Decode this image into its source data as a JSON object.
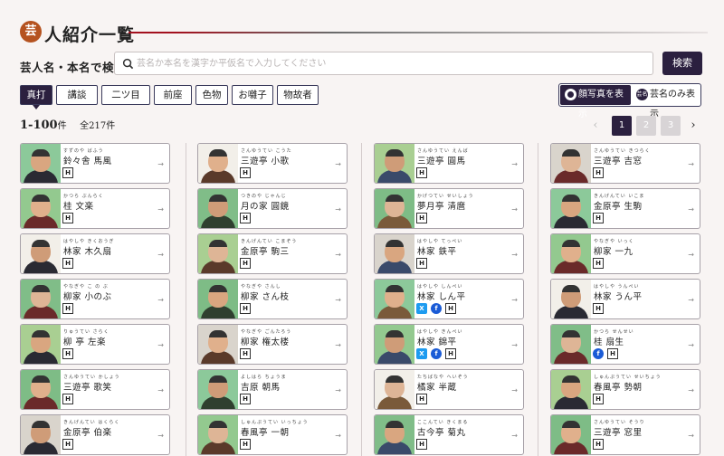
{
  "header": {
    "badge": "芸",
    "title": "人紹介一覧"
  },
  "search": {
    "label": "芸人名・本名で検索",
    "placeholder": "芸名か本名を漢字か平仮名で入力してください",
    "button": "検索"
  },
  "tabs": [
    "真打",
    "講談",
    "二ツ目",
    "前座",
    "色物",
    "お囃子",
    "物故者"
  ],
  "active_tab": "真打",
  "view": {
    "photo_label": "顔写真を表示",
    "name_label": "芸名のみ表示",
    "name_icon": "芸名"
  },
  "results": {
    "range": "1-100",
    "unit": "件",
    "total": "全217件"
  },
  "pagination": {
    "prev": "‹",
    "next": "›",
    "pages": [
      "1",
      "2",
      "3"
    ],
    "current": "1"
  },
  "columns": [
    [
      {
        "ruby": "すずのや ばふう",
        "name": "鈴々舎 馬風",
        "icons": [
          "H"
        ]
      },
      {
        "ruby": "かつら ぶんらく",
        "name": "桂 文楽",
        "icons": [
          "H"
        ]
      },
      {
        "ruby": "はやしや きくおうぎ",
        "name": "林家 木久扇",
        "icons": [
          "H"
        ]
      },
      {
        "ruby": "やなぎや こ の ぶ",
        "name": "柳家 小のぶ",
        "icons": [
          "H"
        ]
      },
      {
        "ruby": "りゅうてい さらく",
        "name": "柳 亭 左楽",
        "icons": [
          "H"
        ]
      },
      {
        "ruby": "さんゆうてい かしょう",
        "name": "三遊亭 歌笑",
        "icons": [
          "H"
        ]
      },
      {
        "ruby": "きんげんてい はくらく",
        "name": "金原亭 伯楽",
        "icons": [
          "H"
        ]
      }
    ],
    [
      {
        "ruby": "さんゆうてい こうた",
        "name": "三遊亭 小歌",
        "icons": [
          "H"
        ]
      },
      {
        "ruby": "つきのや じゃんじ",
        "name": "月の家 圓鏡",
        "icons": [
          "H"
        ]
      },
      {
        "ruby": "きんげんてい こまぞう",
        "name": "金原亭 駒三",
        "icons": [
          "H"
        ]
      },
      {
        "ruby": "やなぎや さんし",
        "name": "柳家 さん枝",
        "icons": [
          "H"
        ]
      },
      {
        "ruby": "やなぎや ごんたろう",
        "name": "柳家 権太楼",
        "icons": [
          "H"
        ]
      },
      {
        "ruby": "よしはら ちょうま",
        "name": "吉原 朝馬",
        "icons": [
          "H"
        ]
      },
      {
        "ruby": "しゅんぷうてい いっちょう",
        "name": "春風亭 一朝",
        "icons": [
          "H"
        ]
      }
    ],
    [
      {
        "ruby": "さんゆうてい えんば",
        "name": "三遊亭 圓馬",
        "icons": [
          "H"
        ]
      },
      {
        "ruby": "かげつてい せいしょう",
        "name": "夢月亭 清麿",
        "icons": [
          "H"
        ]
      },
      {
        "ruby": "はやしや てっぺい",
        "name": "林家 鉄平",
        "icons": [
          "H"
        ]
      },
      {
        "ruby": "はやしや しんぺい",
        "name": "林家 しん平",
        "icons": [
          "X",
          "f",
          "H"
        ]
      },
      {
        "ruby": "はやしや きんぺい",
        "name": "林家 錦平",
        "icons": [
          "X",
          "f",
          "H"
        ]
      },
      {
        "ruby": "たちばなや へいぞう",
        "name": "橘家 半蔵",
        "icons": [
          "H"
        ]
      },
      {
        "ruby": "ここんてい きくまる",
        "name": "古今亭 菊丸",
        "icons": [
          "H"
        ]
      }
    ],
    [
      {
        "ruby": "さんゆうてい きつらく",
        "name": "三遊亭 吉窓",
        "icons": [
          "H"
        ]
      },
      {
        "ruby": "きんげんてい いこま",
        "name": "金原亭 生駒",
        "icons": [
          "H"
        ]
      },
      {
        "ruby": "やなぎや いっく",
        "name": "柳家 一九",
        "icons": [
          "H"
        ]
      },
      {
        "ruby": "はやしや うんぺい",
        "name": "林家 うん平",
        "icons": [
          "H"
        ]
      },
      {
        "ruby": "かつら せんせい",
        "name": "桂 扇生",
        "icons": [
          "f",
          "H"
        ]
      },
      {
        "ruby": "しゅんぷうてい せいちょう",
        "name": "春風亭 勢朝",
        "icons": [
          "H"
        ]
      },
      {
        "ruby": "さんゆうてい そうり",
        "name": "三遊亭 窓里",
        "icons": [
          "H"
        ]
      }
    ]
  ],
  "colors": {
    "accent": "#2b203f",
    "badge": "#b5521f",
    "photo_bg": "#7fbf8a",
    "twitter": "#1d9bf0",
    "facebook": "#1a5bd6"
  },
  "icon_names": {
    "search": "search-icon",
    "arrow": "arrow-right-icon",
    "camera": "camera-icon"
  },
  "arrow_glyph": "→"
}
